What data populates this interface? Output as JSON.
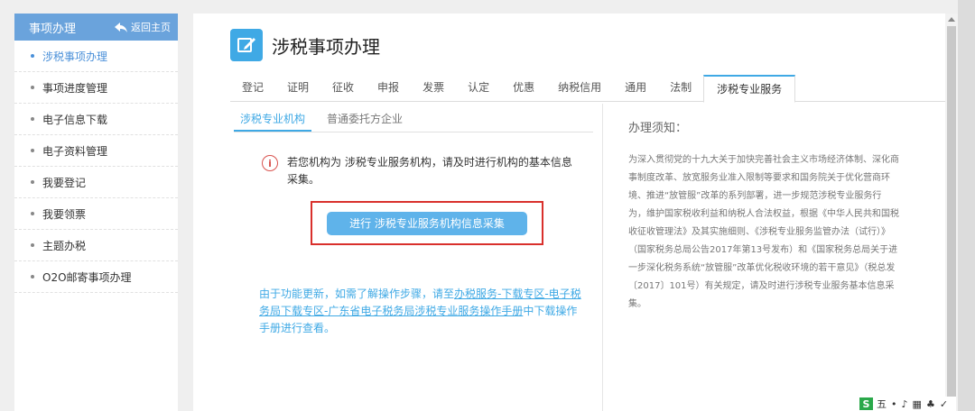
{
  "sidebar": {
    "title": "事项办理",
    "back_label": "返回主页",
    "items": [
      {
        "label": "涉税事项办理"
      },
      {
        "label": "事项进度管理"
      },
      {
        "label": "电子信息下载"
      },
      {
        "label": "电子资料管理"
      },
      {
        "label": "我要登记"
      },
      {
        "label": "我要领票"
      },
      {
        "label": "主题办税"
      },
      {
        "label": "O2O邮寄事项办理"
      }
    ]
  },
  "main": {
    "title": "涉税事项办理",
    "tabs": [
      {
        "label": "登记"
      },
      {
        "label": "证明"
      },
      {
        "label": "征收"
      },
      {
        "label": "申报"
      },
      {
        "label": "发票"
      },
      {
        "label": "认定"
      },
      {
        "label": "优惠"
      },
      {
        "label": "纳税信用"
      },
      {
        "label": "通用"
      },
      {
        "label": "法制"
      },
      {
        "label": "涉税专业服务"
      }
    ],
    "subtabs": [
      {
        "label": "涉税专业机构"
      },
      {
        "label": "普通委托方企业"
      }
    ],
    "notice": "若您机构为 涉税专业服务机构，请及时进行机构的基本信息采集。",
    "button_label": "进行 涉税专业服务机构信息采集",
    "help": {
      "prefix": "由于功能更新，如需了解操作步骤，请至",
      "link1": "办税服务-下载专区-电子税务局下载专区-广东省电子税务局涉税专业服务操作手册",
      "suffix": "中下载操作手册进行查看。"
    },
    "instructions": {
      "title": "办理须知：",
      "body": "为深入贯彻党的十九大关于加快完善社会主义市场经济体制、深化商事制度改革、放宽服务业准入限制等要求和国务院关于优化营商环境、推进“放管服”改革的系列部署，进一步规范涉税专业服务行为，维护国家税收利益和纳税人合法权益，根据《中华人民共和国税收征收管理法》及其实施细则、《涉税专业服务监管办法（试行）》（国家税务总局公告2017年第13号发布）和《国家税务总局关于进一步深化税务系统“放管服”改革优化税收环境的若干意见》（税总发〔2017〕101号）有关规定，请及时进行涉税专业服务基本信息采集。"
    }
  },
  "ime": {
    "logo": "S",
    "items": [
      "五",
      "•",
      "♪",
      "▦",
      "♣",
      "✓"
    ]
  },
  "colors": {
    "accent": "#3fa9e5",
    "sidebar_header": "#6aa3dc",
    "highlight_border": "#d9302c"
  }
}
